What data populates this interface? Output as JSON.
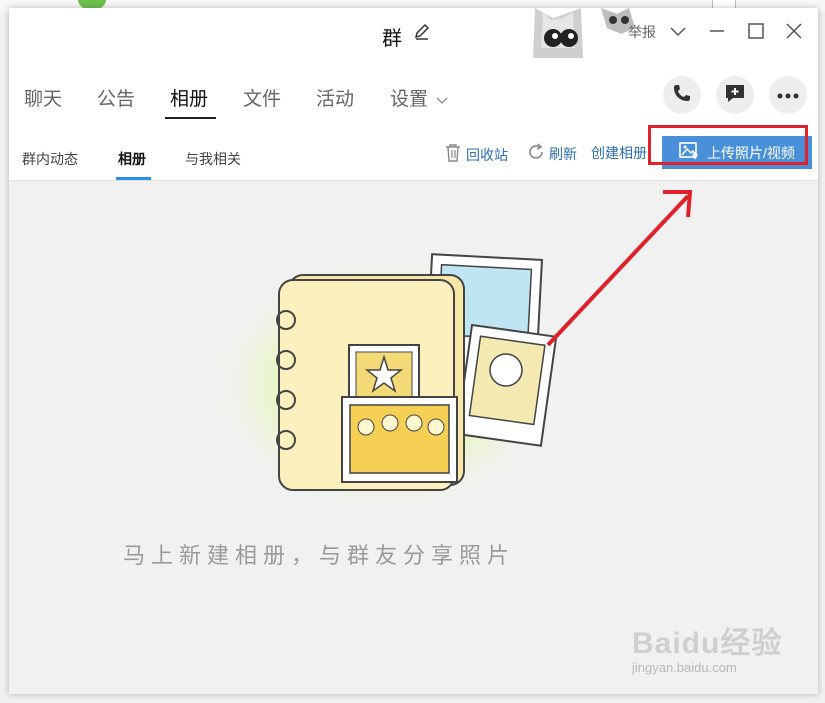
{
  "window": {
    "title": "群",
    "report_label": "举报",
    "buttons": {
      "dropdown": "chevron-down",
      "minimize": "minimize",
      "maximize": "maximize",
      "close": "close"
    }
  },
  "main_tabs": [
    {
      "label": "聊天",
      "active": false
    },
    {
      "label": "公告",
      "active": false
    },
    {
      "label": "相册",
      "active": true
    },
    {
      "label": "文件",
      "active": false
    },
    {
      "label": "活动",
      "active": false
    },
    {
      "label": "设置",
      "active": false
    }
  ],
  "action_icons": [
    "phone-icon",
    "chat-add-icon",
    "more-icon"
  ],
  "sub_tabs": [
    {
      "label": "群内动态",
      "active": false
    },
    {
      "label": "相册",
      "active": true
    },
    {
      "label": "与我相关",
      "active": false
    }
  ],
  "toolbar": {
    "recycle_label": "回收站",
    "refresh_label": "刷新",
    "create_album_label": "创建相册",
    "upload_label": "上传照片/视频"
  },
  "empty_state": {
    "message": "马上新建相册，与群友分享照片"
  },
  "watermark": {
    "logo": "Baidu经验",
    "url": "jingyan.baidu.com"
  },
  "colors": {
    "accent": "#4a90d9",
    "highlight": "#e0202a",
    "link": "#2a6fb5"
  }
}
